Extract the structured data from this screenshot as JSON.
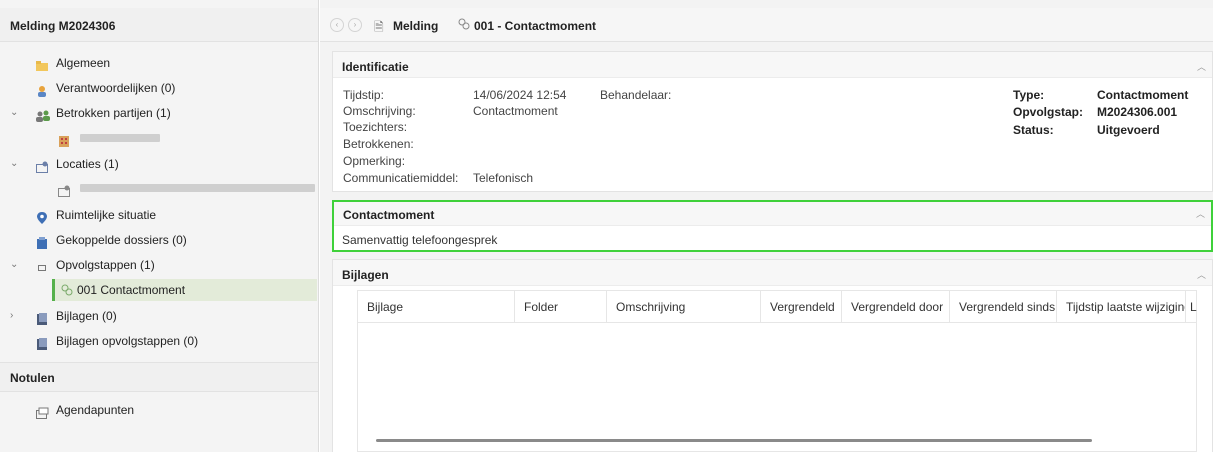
{
  "left_panel": {
    "title": "Melding M2024306",
    "items": [
      {
        "label": "Algemeen",
        "icon": "folder-icon"
      },
      {
        "label": "Verantwoordelijken (0)",
        "icon": "person-icon"
      },
      {
        "label": "Betrokken partijen (1)",
        "icon": "people-icon"
      },
      {
        "label": "Locaties (1)",
        "icon": "location-card-icon"
      },
      {
        "label": "Ruimtelijke situatie",
        "icon": "map-pin-icon"
      },
      {
        "label": "Gekoppelde dossiers (0)",
        "icon": "dossier-icon"
      },
      {
        "label": "Opvolgstappen (1)",
        "icon": "square-icon"
      },
      {
        "label": "001 Contactmoment",
        "icon": "link-icon"
      },
      {
        "label": "Bijlagen (0)",
        "icon": "attachment-icon"
      },
      {
        "label": "Bijlagen opvolgstappen (0)",
        "icon": "attachment-icon"
      }
    ],
    "notulen_title": "Notulen",
    "notulen_items": [
      {
        "label": "Agendapunten",
        "icon": "agenda-icon"
      }
    ]
  },
  "topbar": {
    "crumb1": "Melding",
    "crumb2": "001 - Contactmoment"
  },
  "identificatie": {
    "title": "Identificatie",
    "fields": [
      {
        "label": "Tijdstip:",
        "value": "14/06/2024 12:54"
      },
      {
        "label": "Omschrijving:",
        "value": "Contactmoment"
      },
      {
        "label": "Toezichters:",
        "value": ""
      },
      {
        "label": "Betrokkenen:",
        "value": ""
      },
      {
        "label": "Opmerking:",
        "value": ""
      },
      {
        "label": "Communicatiemiddel:",
        "value": "Telefonisch"
      }
    ],
    "behandelaar_label": "Behandelaar:",
    "right_fields": [
      {
        "label": "Type:",
        "value": "Contactmoment"
      },
      {
        "label": "Opvolgstap:",
        "value": "M2024306.001"
      },
      {
        "label": "Status:",
        "value": "Uitgevoerd"
      }
    ]
  },
  "contactmoment": {
    "title": "Contactmoment",
    "text": "Samenvattig telefoongesprek"
  },
  "bijlagen": {
    "title": "Bijlagen",
    "columns": [
      "Bijlage",
      "Folder",
      "Omschrijving",
      "Vergrendeld",
      "Vergrendeld door",
      "Vergrendeld sinds",
      "Tijdstip laatste wijziging",
      "L"
    ]
  },
  "colors": {
    "accent_green": "#3fd13a",
    "selected_bg": "#e3ebd9"
  }
}
